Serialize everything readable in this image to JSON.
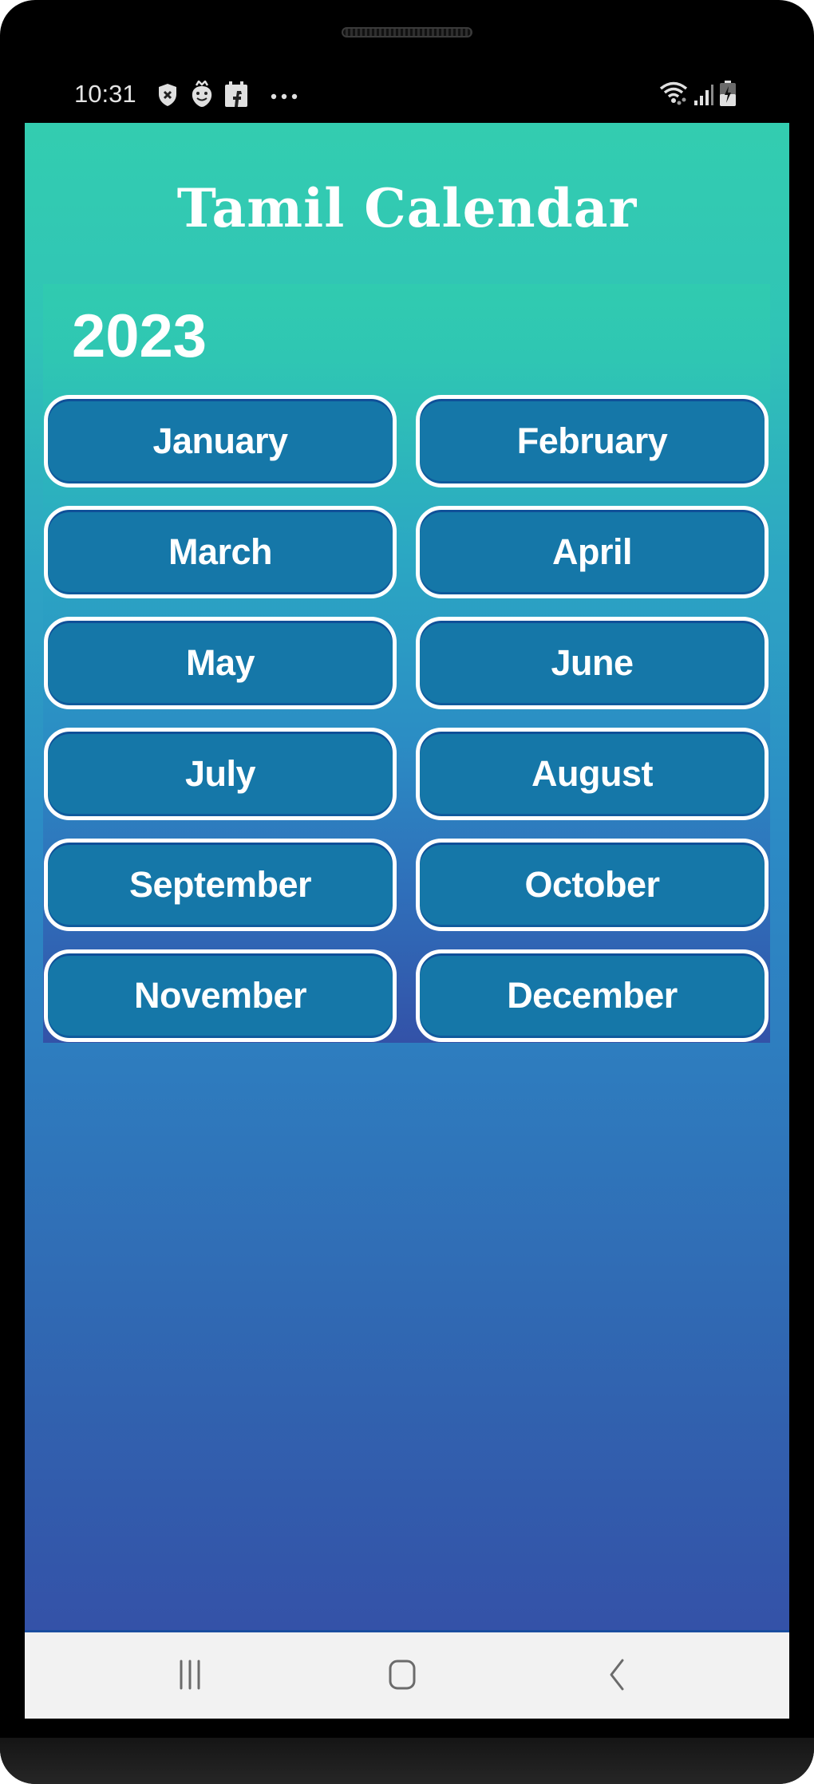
{
  "status_bar": {
    "time": "10:31",
    "left_icons": [
      "shield-x-icon",
      "face-notification-icon",
      "calendar-notification-icon",
      "more-dots-icon"
    ],
    "right_icons": [
      "wifi-icon",
      "signal-icon",
      "battery-charging-icon"
    ]
  },
  "app": {
    "title": "Tamil Calendar",
    "year": "2023",
    "months": [
      {
        "label": "January"
      },
      {
        "label": "February"
      },
      {
        "label": "March"
      },
      {
        "label": "April"
      },
      {
        "label": "May"
      },
      {
        "label": "June"
      },
      {
        "label": "July"
      },
      {
        "label": "August"
      },
      {
        "label": "September"
      },
      {
        "label": "October"
      },
      {
        "label": "November"
      },
      {
        "label": "December"
      }
    ]
  },
  "nav_bar": {
    "buttons": [
      "recent-apps",
      "home",
      "back"
    ]
  },
  "colors": {
    "button_fill": "#1577a8",
    "button_border": "#ffffff",
    "gradient_top": "#33cdb0",
    "gradient_bottom": "#3452a8",
    "nav_bar_bg": "#f2f2f2"
  }
}
